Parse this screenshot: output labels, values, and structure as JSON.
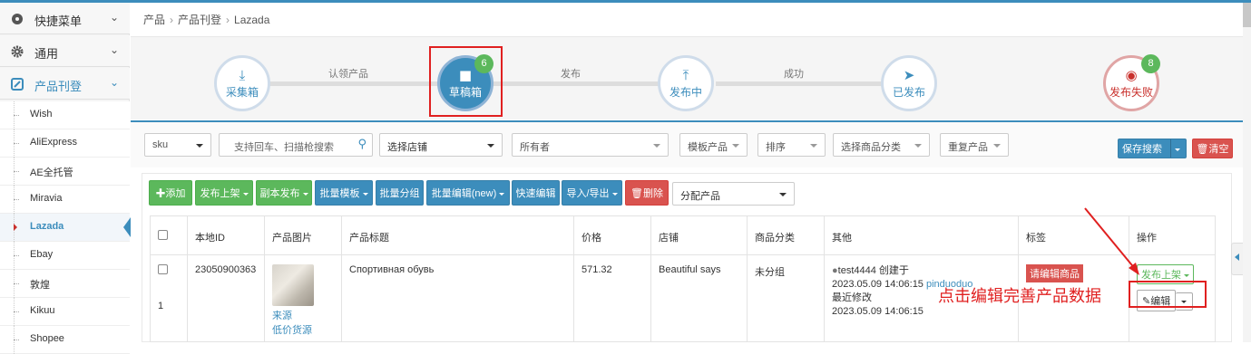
{
  "sidebar": {
    "menus": [
      {
        "label": "快捷菜单",
        "icon": "dashboard-icon"
      },
      {
        "label": "通用",
        "icon": "gear-icon"
      },
      {
        "label": "产品刊登",
        "icon": "edit-icon"
      }
    ],
    "items": [
      "Wish",
      "AliExpress",
      "AE全托管",
      "Miravia",
      "Lazada",
      "Ebay",
      "敦煌",
      "Kikuu",
      "Shopee"
    ],
    "active_item": "Lazada"
  },
  "breadcrumb": [
    "产品",
    "产品刊登",
    "Lazada"
  ],
  "steps": {
    "items": [
      {
        "label": "采集箱",
        "icon": "download-icon"
      },
      {
        "label": "草稿箱",
        "icon": "folder-icon",
        "badge": "6"
      },
      {
        "label": "发布中",
        "icon": "upload-icon"
      },
      {
        "label": "已发布",
        "icon": "send-icon"
      },
      {
        "label": "发布失败",
        "icon": "eye-slash-icon",
        "badge": "8"
      }
    ],
    "connectors": [
      "认领产品",
      "发布",
      "成功"
    ]
  },
  "filters": {
    "sku": "sku",
    "search_placeholder": "支持回车、扫描枪搜索",
    "shop": "选择店铺",
    "owner": "所有者",
    "template": "模板产品",
    "sort": "排序",
    "category": "选择商品分类",
    "duplicate": "重复产品",
    "save_search": "保存搜索",
    "clear": "清空"
  },
  "toolbar": {
    "add": "添加",
    "publish_listing": "发布上架",
    "copy_publish": "副本发布",
    "batch_template": "批量模板",
    "batch_group": "批量分组",
    "batch_edit_new": "批量编辑(new)",
    "quick_edit": "快速编辑",
    "import_export": "导入/导出",
    "delete": "删除",
    "assign_product": "分配产品"
  },
  "table": {
    "headers": [
      "本地ID",
      "产品图片",
      "产品标题",
      "价格",
      "店铺",
      "商品分类",
      "其他",
      "标签",
      "操作"
    ],
    "rows": [
      {
        "index": "1",
        "local_id": "23050900363",
        "image_source": "来源",
        "image_supplier": "低价货源",
        "title": "Спортивная обувь",
        "price": "571.32",
        "shop": "Beautiful says",
        "category": "未分组",
        "creator": "test4444",
        "created_label": "创建于",
        "created_time": "2023.05.09 14:06:15",
        "source_platform": "pinduoduo",
        "modified_label": "最近修改",
        "modified_time": "2023.05.09 14:06:15",
        "tag": "请编辑商品",
        "action_publish": "发布上架",
        "action_edit": "编辑"
      }
    ]
  },
  "annotation": "点击编辑完善产品数据",
  "colors": {
    "primary": "#3c8dbc",
    "success": "#5cb85c",
    "danger": "#d9534f",
    "highlight": "#e02020"
  }
}
